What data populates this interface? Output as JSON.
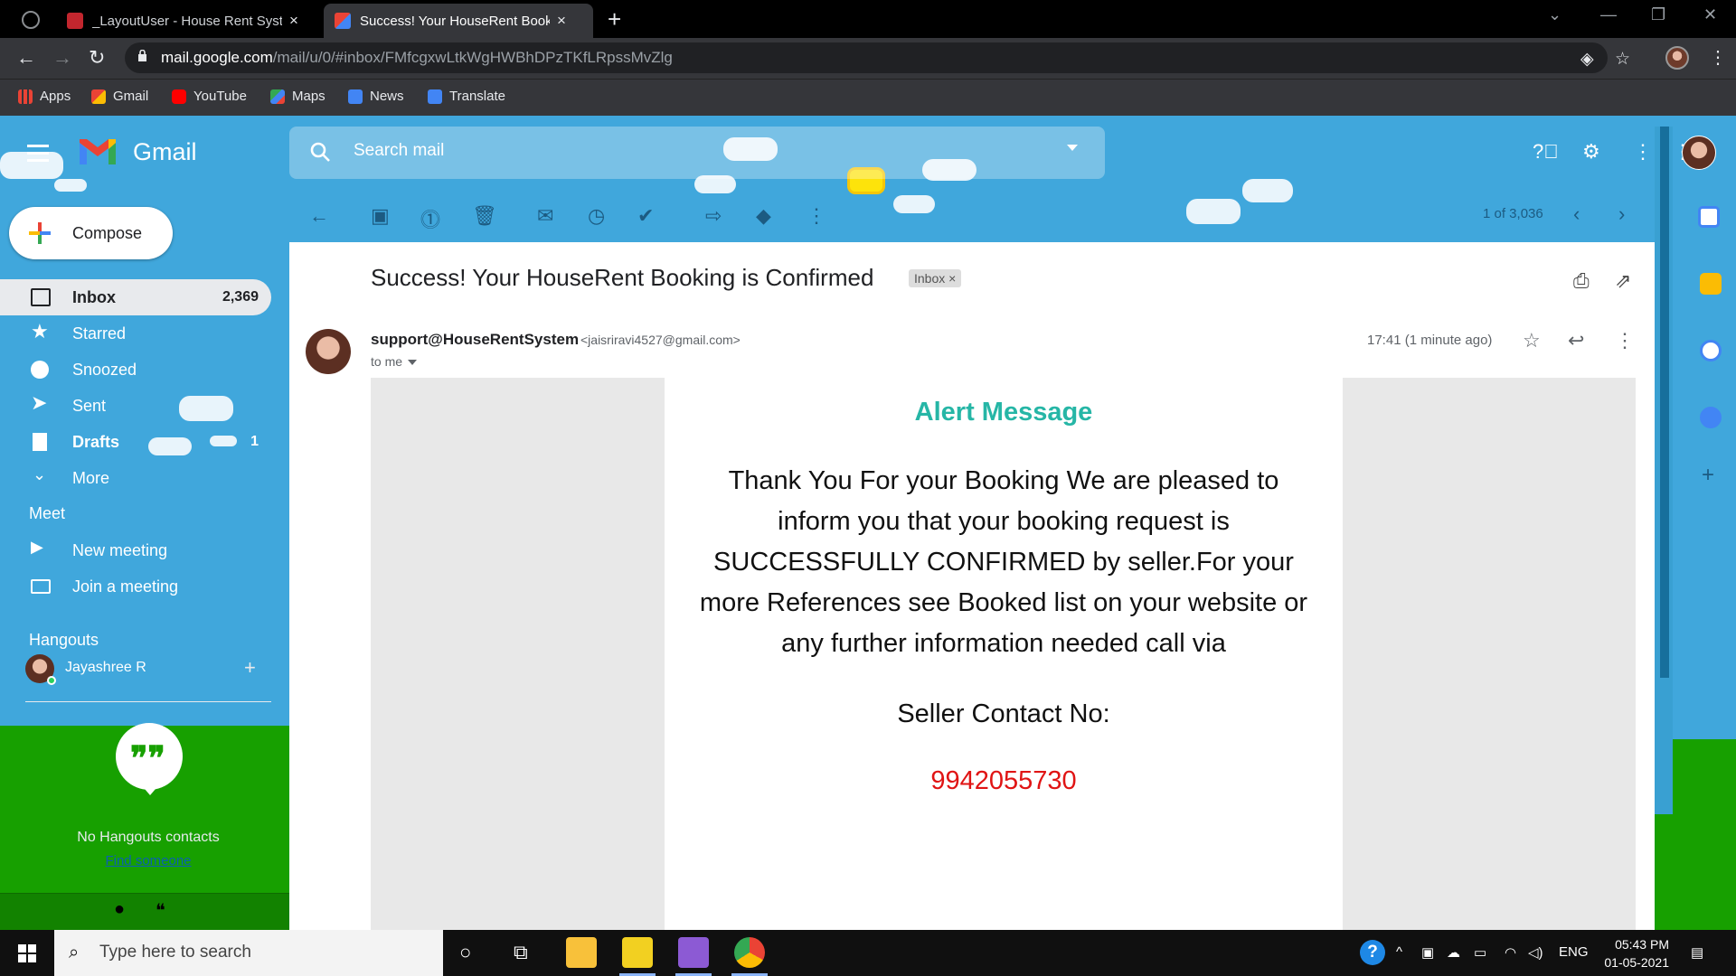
{
  "browser": {
    "tabs": [
      {
        "title": "_LayoutUser - House Rent System",
        "active": false
      },
      {
        "title": "Success! Your HouseRent Booking is Confirmed",
        "active": true
      }
    ],
    "url_host": "mail.google.com",
    "url_path": "/mail/u/0/#inbox/FMfcgxwLtkWgHWBhDPzTKfLRpssMvZlg",
    "bookmarks": [
      "Apps",
      "Gmail",
      "YouTube",
      "Maps",
      "News",
      "Translate"
    ]
  },
  "gmail": {
    "brand": "Gmail",
    "search_placeholder": "Search mail",
    "compose_label": "Compose",
    "nav": [
      {
        "label": "Inbox",
        "count": "2,369"
      },
      {
        "label": "Starred",
        "count": ""
      },
      {
        "label": "Snoozed",
        "count": ""
      },
      {
        "label": "Sent",
        "count": ""
      },
      {
        "label": "Drafts",
        "count": "1"
      },
      {
        "label": "More",
        "count": ""
      }
    ],
    "meet": {
      "title": "Meet",
      "items": [
        "New meeting",
        "Join a meeting"
      ]
    },
    "hangouts": {
      "title": "Hangouts",
      "user": "Jayashree R",
      "empty_text": "No Hangouts contacts",
      "find_link": "Find someone"
    },
    "pagination": "1 of 3,036"
  },
  "message": {
    "subject": "Success! Your HouseRent Booking is Confirmed",
    "label_chip": "Inbox",
    "sender_name": "support@HouseRentSystem",
    "sender_email": "<jaisriravi4527@gmail.com>",
    "to": "to me",
    "time": "17:41 (1 minute ago)",
    "body": {
      "title": "Alert Message",
      "text": "Thank You For your Booking We are pleased to inform you that your booking request is SUCCESSFULLY CONFIRMED by seller.For your more References see Booked list on your website or any further information needed call via",
      "contact_label": "Seller Contact No:",
      "contact_number": "9942055730"
    }
  },
  "taskbar": {
    "search_placeholder": "Type here to search",
    "language": "ENG",
    "time": "05:43 PM",
    "date": "01-05-2021"
  },
  "colors": {
    "gmail_theme": "#40a7dc",
    "alert_title": "#26b6a6",
    "contact_number": "#e01414",
    "grass": "#17a000"
  }
}
